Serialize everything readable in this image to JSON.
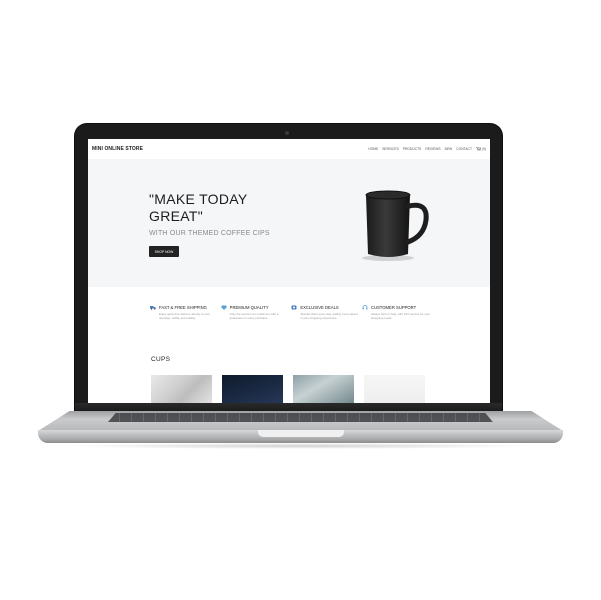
{
  "site": {
    "brand": "MINI ONLINE STORE",
    "nav": [
      "HOME",
      "SERVICES",
      "PRODUCTS",
      "REVIEWS",
      "NEW",
      "CONTACT"
    ],
    "cart_label": "(0)"
  },
  "hero": {
    "title_line1": "\"MAKE TODAY",
    "title_line2": "GREAT\"",
    "subtitle": "WITH OUR THEMED COFFEE CIPS",
    "button": "SHOP NOW"
  },
  "features": [
    {
      "title": "FAST & FREE SHIPPING",
      "desc": "Enjoy quick free delivery directly to your doorstep, swiftly and reliably.",
      "icon": "truck-icon"
    },
    {
      "title": "PREMIUM QUALITY",
      "desc": "Only the best for our customers with a guarantee on every purchase.",
      "icon": "diamond-icon"
    },
    {
      "title": "EXCLUSIVE DEALS",
      "desc": "Special offers every day, adding more savers in your shopping experience.",
      "icon": "tag-icon"
    },
    {
      "title": "CUSTOMER SUPPORT",
      "desc": "Always here to help, with 24/7 service for your shopping needs.",
      "icon": "headset-icon"
    }
  ],
  "cups": {
    "title": "CUPS"
  },
  "colors": {
    "bezel": "#1b1b1c",
    "hero_bg": "#f5f6f7",
    "button": "#222222",
    "aluminum": "#c9cacc"
  }
}
